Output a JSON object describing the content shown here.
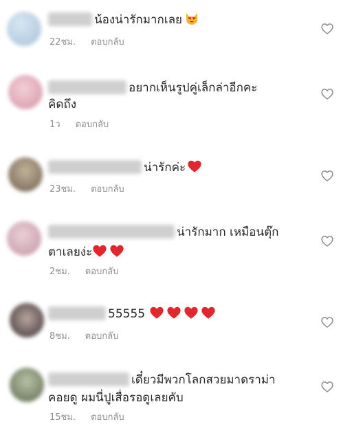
{
  "comments": [
    {
      "avatar_colors": [
        "#c7dced",
        "#9fb9d3"
      ],
      "lines": [
        "น้องน่ารักมากเลย"
      ],
      "emoji": "smiling-cat-heart-eyes",
      "time": "22ชม.",
      "reply_label": "ตอบกลับ"
    },
    {
      "avatar_colors": [
        "#eec1cc",
        "#d493a4"
      ],
      "lines": [
        "อยากเห็นรูปคู่เล็กล่าอีกคะ",
        "คิดถึง"
      ],
      "time": "1ว",
      "reply_label": "ตอบกลับ"
    },
    {
      "avatar_colors": [
        "#b7a890",
        "#6e5f4f"
      ],
      "lines": [
        "น่ารักค่ะ"
      ],
      "emoji": "red-heart",
      "time": "23ชม.",
      "reply_label": "ตอบกลับ"
    },
    {
      "avatar_colors": [
        "#e6c7cf",
        "#c79aa8"
      ],
      "lines": [
        "น่ารักมาก เหมือนตุ๊ก",
        "ตาเลยง่ะ"
      ],
      "emoji_count": 2,
      "time": "2ชม.",
      "reply_label": "ตอบกลับ"
    },
    {
      "avatar_colors": [
        "#a89590",
        "#3b3030"
      ],
      "lines": [
        "55555"
      ],
      "emoji_count": 4,
      "time": "8ชม.",
      "reply_label": "ตอบกลับ"
    },
    {
      "avatar_colors": [
        "#a9b394",
        "#5d6a50"
      ],
      "lines": [
        "เดี๋ยวมีพวกโลกสวยมาดราม่า",
        "คอยดู ผมนี่ปูเสื่อรอดูเลยคับ"
      ],
      "time": "15ชม.",
      "reply_label": "ตอบกลับ"
    }
  ],
  "colors": {
    "text": "#262626",
    "secondary": "#8e8e8e",
    "heart_outline": "#8e8e8e",
    "emoji_heart": "#e0272e"
  },
  "icons": {
    "like": "heart-outline-icon",
    "emoji_heart": "red-heart-emoji",
    "emoji_cat": "smiling-cat-heart-eyes-emoji"
  }
}
